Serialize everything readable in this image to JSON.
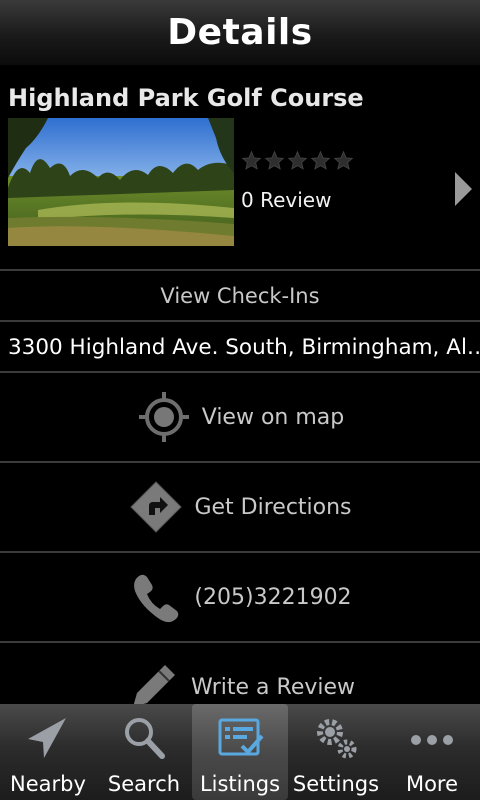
{
  "header": {
    "title": "Details"
  },
  "place": {
    "name": "Highland Park Golf Course",
    "rating": 0,
    "rating_max": 5,
    "review_count_label": "0 Review"
  },
  "rows": {
    "checkins_label": "View Check-Ins",
    "address": "3300 Highland Ave. South, Birmingham, Al…",
    "map_label": "View on map",
    "directions_label": "Get Directions",
    "phone": "(205)3221902",
    "review_label": "Write a Review"
  },
  "tabs": [
    {
      "label": "Nearby",
      "icon": "navigation-arrow-icon",
      "active": false
    },
    {
      "label": "Search",
      "icon": "magnifier-icon",
      "active": false
    },
    {
      "label": "Listings",
      "icon": "checklist-icon",
      "active": true
    },
    {
      "label": "Settings",
      "icon": "gears-icon",
      "active": false
    },
    {
      "label": "More",
      "icon": "dots-icon",
      "active": false
    }
  ],
  "colors": {
    "background": "#000000",
    "divider": "#3b3b3b",
    "secondary_text": "#c9c9c9",
    "active_tab_icon": "#5aa8e0"
  }
}
